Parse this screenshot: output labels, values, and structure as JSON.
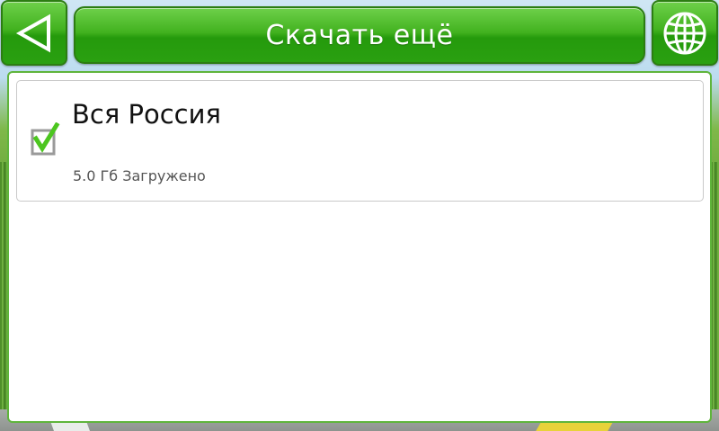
{
  "header": {
    "title": "Скачать ещё",
    "back_icon": "back-arrow-icon",
    "globe_icon": "globe-icon"
  },
  "list": {
    "items": [
      {
        "title": "Вся Россия",
        "status": "5.0 Гб Загружено",
        "checked": true,
        "check_icon": "checkbox-checked-icon"
      }
    ]
  },
  "colors": {
    "accent_green": "#3aab19",
    "panel_border": "#5fb53c",
    "check_green": "#4cc61f"
  }
}
